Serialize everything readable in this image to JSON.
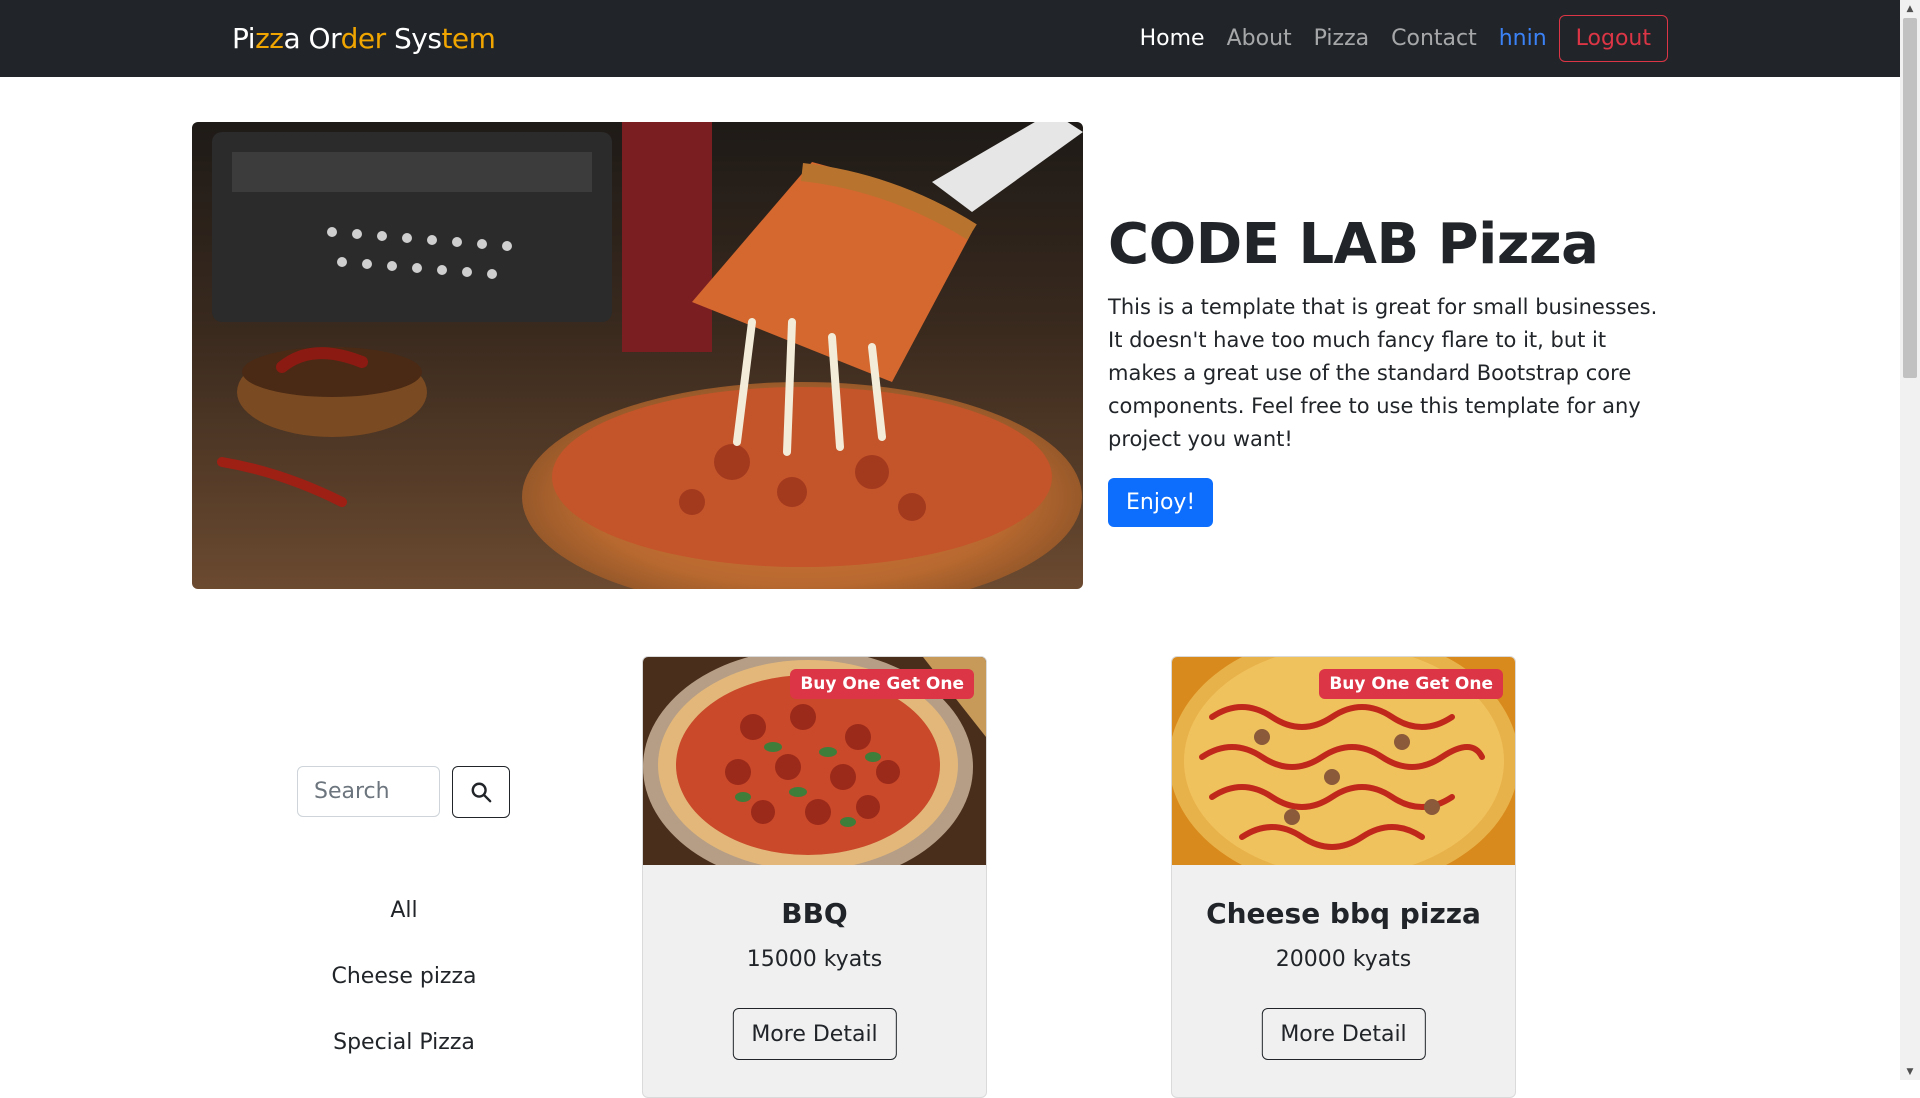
{
  "navbar": {
    "brand": [
      "Pi",
      "zz",
      "a Or",
      "der",
      " Sys",
      "tem"
    ],
    "links": [
      {
        "label": "Home",
        "active": true
      },
      {
        "label": "About",
        "active": false
      },
      {
        "label": "Pizza",
        "active": false
      },
      {
        "label": "Contact",
        "active": false
      }
    ],
    "user": "hnin",
    "logout_label": "Logout"
  },
  "hero": {
    "title": "CODE LAB Pizza",
    "description": "This is a template that is great for small businesses. It doesn't have too much fancy flare to it, but it makes a great use of the standard Bootstrap core components. Feel free to use this template for any project you want!",
    "button_label": "Enjoy!"
  },
  "sidebar": {
    "search_placeholder": "Search",
    "categories": [
      "All",
      "Cheese pizza",
      "Special Pizza"
    ]
  },
  "products": [
    {
      "name": "BBQ",
      "price": "15000 kyats",
      "badge": "Buy One Get One",
      "button_label": "More Detail"
    },
    {
      "name": "Cheese bbq pizza",
      "price": "20000 kyats",
      "badge": "Buy One Get One",
      "button_label": "More Detail"
    }
  ],
  "colors": {
    "navbar": "#212529",
    "primary": "#0d6efd",
    "danger": "#dc3545",
    "brand_accent": "#f0a500"
  }
}
